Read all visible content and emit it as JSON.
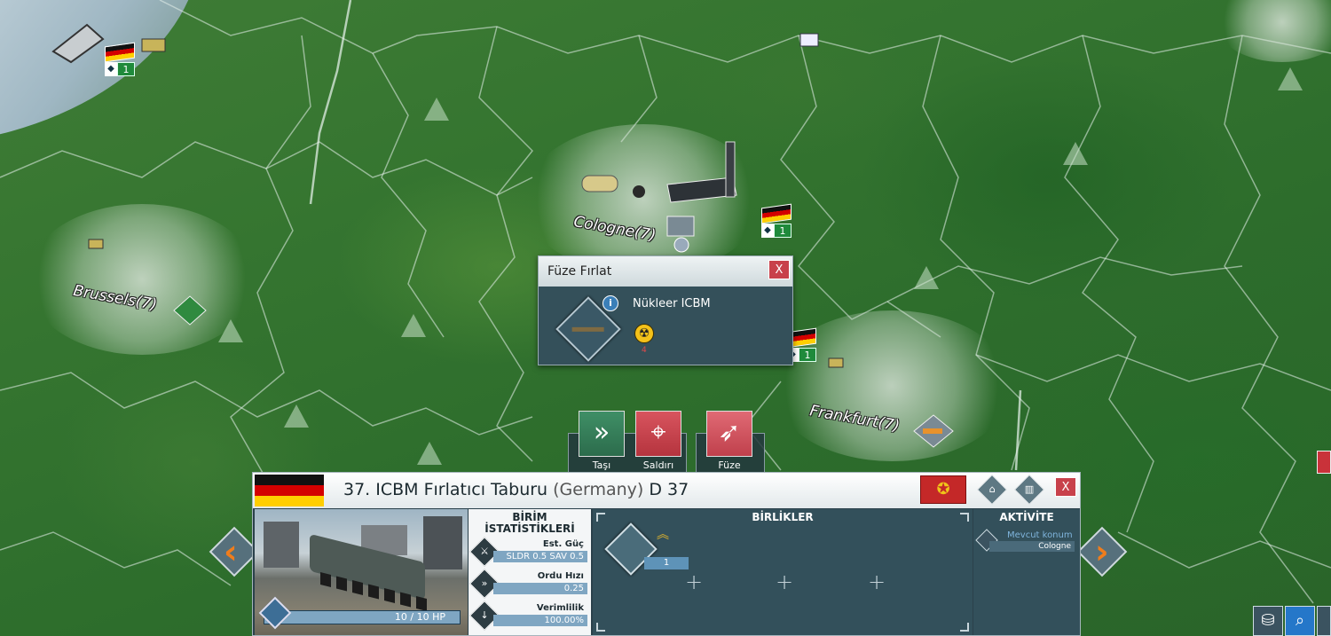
{
  "map": {
    "cities": [
      {
        "name": "Cologne(7)"
      },
      {
        "name": "Brussels(7)"
      },
      {
        "name": "Frankfurt(7)"
      }
    ],
    "markers": [
      {
        "count": "1"
      },
      {
        "count": "1"
      },
      {
        "count": "1"
      }
    ]
  },
  "launch_popup": {
    "title": "Füze Fırlat",
    "close": "X",
    "missile_name": "Nükleer ICBM",
    "info": "i",
    "count": "4"
  },
  "actions": {
    "move_label": "Taşı",
    "attack_label": "Saldırı",
    "missile_label": "Füze"
  },
  "unit_panel": {
    "title": "37. ICBM Fırlatıcı Taburu",
    "country": "(Germany)",
    "code": "D 37",
    "close": "X",
    "hp": "10 / 10 HP",
    "stats": {
      "title_line1": "BİRİM",
      "title_line2": "İSTATİSTİKLERİ",
      "rows": [
        {
          "label": "Est. Güç",
          "value": "SLDR 0.5 SAV 0.5"
        },
        {
          "label": "Ordu Hızı",
          "value": "0.25"
        },
        {
          "label": "Verimlilik",
          "value": "100.00%"
        }
      ]
    },
    "units_section": {
      "title": "BİRLİKLER",
      "unit_count": "1"
    },
    "activity": {
      "title": "AKTİVİTE",
      "location_label": "Mevcut konum",
      "location_value": "Cologne"
    }
  },
  "icons": {
    "move": "chevrons-right-icon",
    "attack": "crosshair-icon",
    "missile": "missile-icon",
    "prev": "arrow-left-icon",
    "next": "arrow-right-icon",
    "database": "database-icon",
    "search": "search-icon"
  },
  "colors": {
    "accent_red": "#c8414b",
    "accent_green": "#2f7d55",
    "nav_orange": "#f07d1c",
    "panel_dark": "#2b414b"
  }
}
